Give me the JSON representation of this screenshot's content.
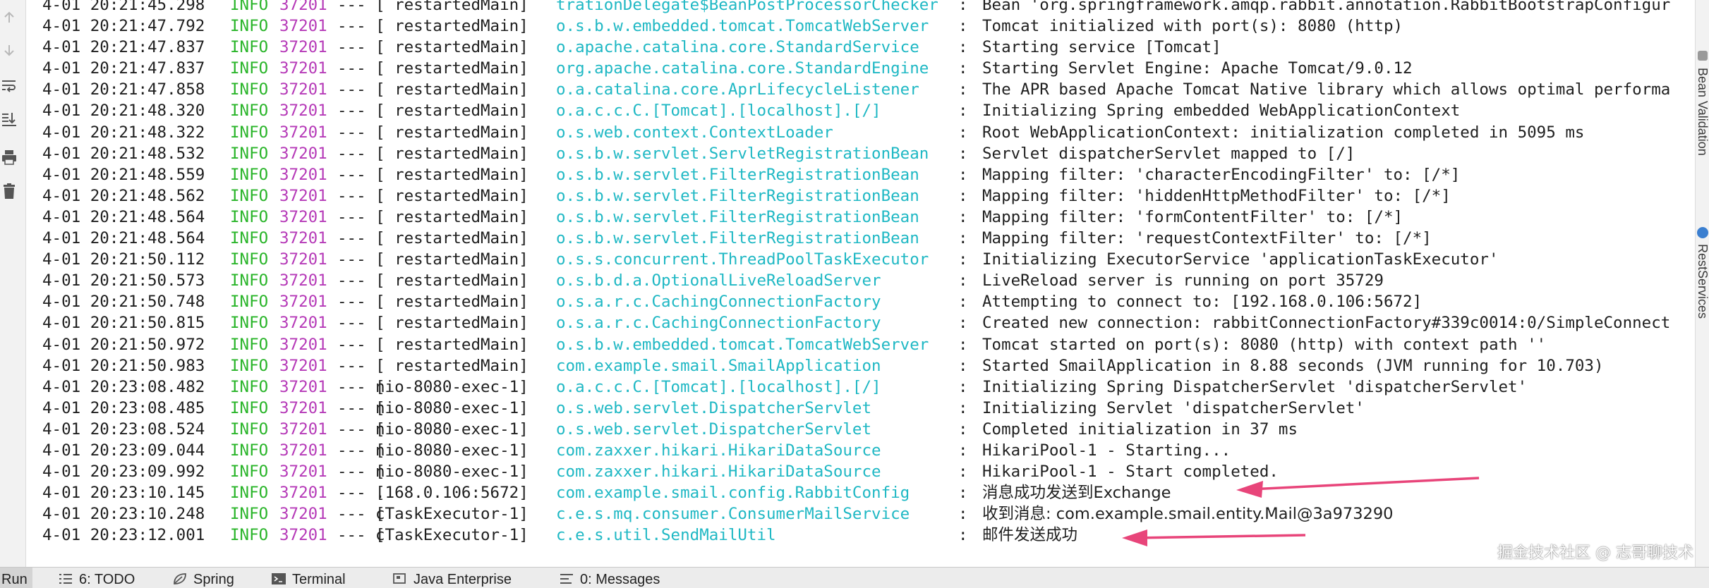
{
  "console": {
    "rows": [
      {
        "ts": "4-01 20:21:45.298",
        "level": "INFO",
        "pid": "37201",
        "sep": "--- [",
        "thread": "  restartedMain]",
        "logger": "trationDelegate$BeanPostProcessorChecker",
        "msg": "Bean 'org.springframework.amqp.rabbit.annotation.RabbitBootstrapConfigur"
      },
      {
        "ts": "4-01 20:21:47.792",
        "level": "INFO",
        "pid": "37201",
        "sep": "--- [",
        "thread": "  restartedMain]",
        "logger": "o.s.b.w.embedded.tomcat.TomcatWebServer",
        "msg": "Tomcat initialized with port(s): 8080 (http)"
      },
      {
        "ts": "4-01 20:21:47.837",
        "level": "INFO",
        "pid": "37201",
        "sep": "--- [",
        "thread": "  restartedMain]",
        "logger": "o.apache.catalina.core.StandardService",
        "msg": "Starting service [Tomcat]"
      },
      {
        "ts": "4-01 20:21:47.837",
        "level": "INFO",
        "pid": "37201",
        "sep": "--- [",
        "thread": "  restartedMain]",
        "logger": "org.apache.catalina.core.StandardEngine",
        "msg": "Starting Servlet Engine: Apache Tomcat/9.0.12"
      },
      {
        "ts": "4-01 20:21:47.858",
        "level": "INFO",
        "pid": "37201",
        "sep": "--- [",
        "thread": "  restartedMain]",
        "logger": "o.a.catalina.core.AprLifecycleListener",
        "msg": "The APR based Apache Tomcat Native library which allows optimal performa"
      },
      {
        "ts": "4-01 20:21:48.320",
        "level": "INFO",
        "pid": "37201",
        "sep": "--- [",
        "thread": "  restartedMain]",
        "logger": "o.a.c.c.C.[Tomcat].[localhost].[/]",
        "msg": "Initializing Spring embedded WebApplicationContext"
      },
      {
        "ts": "4-01 20:21:48.322",
        "level": "INFO",
        "pid": "37201",
        "sep": "--- [",
        "thread": "  restartedMain]",
        "logger": "o.s.web.context.ContextLoader",
        "msg": "Root WebApplicationContext: initialization completed in 5095 ms"
      },
      {
        "ts": "4-01 20:21:48.532",
        "level": "INFO",
        "pid": "37201",
        "sep": "--- [",
        "thread": "  restartedMain]",
        "logger": "o.s.b.w.servlet.ServletRegistrationBean",
        "msg": "Servlet dispatcherServlet mapped to [/]"
      },
      {
        "ts": "4-01 20:21:48.559",
        "level": "INFO",
        "pid": "37201",
        "sep": "--- [",
        "thread": "  restartedMain]",
        "logger": "o.s.b.w.servlet.FilterRegistrationBean",
        "msg": "Mapping filter: 'characterEncodingFilter' to: [/*]"
      },
      {
        "ts": "4-01 20:21:48.562",
        "level": "INFO",
        "pid": "37201",
        "sep": "--- [",
        "thread": "  restartedMain]",
        "logger": "o.s.b.w.servlet.FilterRegistrationBean",
        "msg": "Mapping filter: 'hiddenHttpMethodFilter' to: [/*]"
      },
      {
        "ts": "4-01 20:21:48.564",
        "level": "INFO",
        "pid": "37201",
        "sep": "--- [",
        "thread": "  restartedMain]",
        "logger": "o.s.b.w.servlet.FilterRegistrationBean",
        "msg": "Mapping filter: 'formContentFilter' to: [/*]"
      },
      {
        "ts": "4-01 20:21:48.564",
        "level": "INFO",
        "pid": "37201",
        "sep": "--- [",
        "thread": "  restartedMain]",
        "logger": "o.s.b.w.servlet.FilterRegistrationBean",
        "msg": "Mapping filter: 'requestContextFilter' to: [/*]"
      },
      {
        "ts": "4-01 20:21:50.112",
        "level": "INFO",
        "pid": "37201",
        "sep": "--- [",
        "thread": "  restartedMain]",
        "logger": "o.s.s.concurrent.ThreadPoolTaskExecutor",
        "msg": "Initializing ExecutorService 'applicationTaskExecutor'"
      },
      {
        "ts": "4-01 20:21:50.573",
        "level": "INFO",
        "pid": "37201",
        "sep": "--- [",
        "thread": "  restartedMain]",
        "logger": "o.s.b.d.a.OptionalLiveReloadServer",
        "msg": "LiveReload server is running on port 35729"
      },
      {
        "ts": "4-01 20:21:50.748",
        "level": "INFO",
        "pid": "37201",
        "sep": "--- [",
        "thread": "  restartedMain]",
        "logger": "o.s.a.r.c.CachingConnectionFactory",
        "msg": "Attempting to connect to: [192.168.0.106:5672]"
      },
      {
        "ts": "4-01 20:21:50.815",
        "level": "INFO",
        "pid": "37201",
        "sep": "--- [",
        "thread": "  restartedMain]",
        "logger": "o.s.a.r.c.CachingConnectionFactory",
        "msg": "Created new connection: rabbitConnectionFactory#339c0014:0/SimpleConnect"
      },
      {
        "ts": "4-01 20:21:50.972",
        "level": "INFO",
        "pid": "37201",
        "sep": "--- [",
        "thread": "  restartedMain]",
        "logger": "o.s.b.w.embedded.tomcat.TomcatWebServer",
        "msg": "Tomcat started on port(s): 8080 (http) with context path ''"
      },
      {
        "ts": "4-01 20:21:50.983",
        "level": "INFO",
        "pid": "37201",
        "sep": "--- [",
        "thread": "  restartedMain]",
        "logger": "com.example.smail.SmailApplication",
        "msg": "Started SmailApplication in 8.88 seconds (JVM running for 10.703)"
      },
      {
        "ts": "4-01 20:23:08.482",
        "level": "INFO",
        "pid": "37201",
        "sep": "--- [",
        "thread": "nio-8080-exec-1]",
        "logger": "o.a.c.c.C.[Tomcat].[localhost].[/]",
        "msg": "Initializing Spring DispatcherServlet 'dispatcherServlet'"
      },
      {
        "ts": "4-01 20:23:08.485",
        "level": "INFO",
        "pid": "37201",
        "sep": "--- [",
        "thread": "nio-8080-exec-1]",
        "logger": "o.s.web.servlet.DispatcherServlet",
        "msg": "Initializing Servlet 'dispatcherServlet'"
      },
      {
        "ts": "4-01 20:23:08.524",
        "level": "INFO",
        "pid": "37201",
        "sep": "--- [",
        "thread": "nio-8080-exec-1]",
        "logger": "o.s.web.servlet.DispatcherServlet",
        "msg": "Completed initialization in 37 ms"
      },
      {
        "ts": "4-01 20:23:09.044",
        "level": "INFO",
        "pid": "37201",
        "sep": "--- [",
        "thread": "nio-8080-exec-1]",
        "logger": "com.zaxxer.hikari.HikariDataSource",
        "msg": "HikariPool-1 - Starting..."
      },
      {
        "ts": "4-01 20:23:09.992",
        "level": "INFO",
        "pid": "37201",
        "sep": "--- [",
        "thread": "nio-8080-exec-1]",
        "logger": "com.zaxxer.hikari.HikariDataSource",
        "msg": "HikariPool-1 - Start completed."
      },
      {
        "ts": "4-01 20:23:10.145",
        "level": "INFO",
        "pid": "37201",
        "sep": "--- [",
        "thread": ".168.0.106:5672]",
        "logger": "com.example.smail.config.RabbitConfig",
        "msg": "消息成功发送到Exchange"
      },
      {
        "ts": "4-01 20:23:10.248",
        "level": "INFO",
        "pid": "37201",
        "sep": "--- [",
        "thread": "cTaskExecutor-1]",
        "logger": "c.e.s.mq.consumer.ConsumerMailService",
        "msg": "收到消息: com.example.smail.entity.Mail@3a973290"
      },
      {
        "ts": "4-01 20:23:12.001",
        "level": "INFO",
        "pid": "37201",
        "sep": "--- [",
        "thread": "cTaskExecutor-1]",
        "logger": "c.e.s.util.SendMailUtil",
        "msg": "邮件发送成功"
      }
    ]
  },
  "right_strip": {
    "items": [
      "Bean Validation",
      "RestServices"
    ]
  },
  "toolbar": {
    "run_label": "Run",
    "tabs": [
      {
        "label": "6: TODO",
        "icon": "list-icon"
      },
      {
        "label": "Spring",
        "icon": "spring-leaf-icon"
      },
      {
        "label": "Terminal",
        "icon": "terminal-icon"
      },
      {
        "label": "Java Enterprise",
        "icon": "java-enterprise-icon"
      },
      {
        "label": "0: Messages",
        "icon": "messages-icon"
      }
    ]
  },
  "watermark": "掘金技术社区 @ 志哥聊技术",
  "colors": {
    "level": "#2ab52a",
    "pid": "#b63ab8",
    "logger": "#1fb8c4",
    "arrow": "#e8457a"
  }
}
